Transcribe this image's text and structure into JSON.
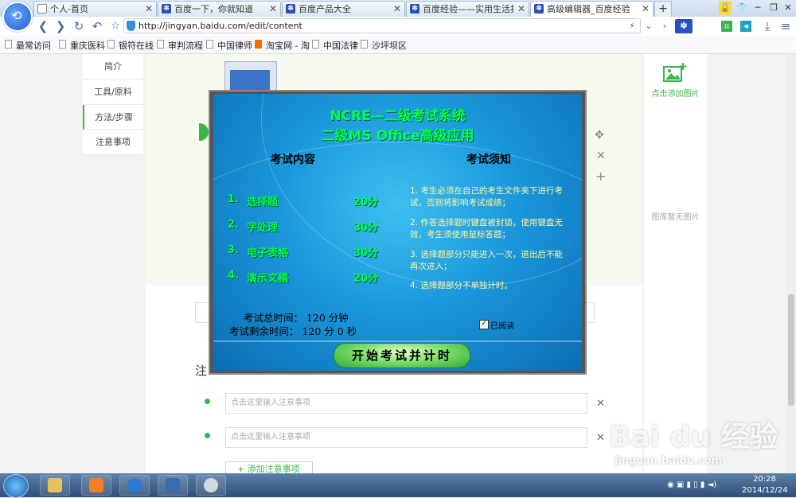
{
  "browser": {
    "tabs": [
      {
        "label": "个人-首页",
        "icon": "page-icon",
        "active": false
      },
      {
        "label": "百度一下，你就知道",
        "icon": "baidu-paw-icon",
        "active": false
      },
      {
        "label": "百度产品大全",
        "icon": "baidu-paw-icon",
        "active": false
      },
      {
        "label": "百度经验——实用生活指南",
        "icon": "baidu-paw-icon",
        "active": false
      },
      {
        "label": "高级编辑器_百度经验",
        "icon": "baidu-paw-icon",
        "active": true
      }
    ],
    "new_tab": "+",
    "url": "http://jingyan.baidu.com/edit/content",
    "bookmarks": [
      "最常访问",
      "重庆医科",
      "银符在线",
      "审判流程",
      "中国律师",
      "淘宝网 - 淘",
      "中国法律",
      "沙坪坝区"
    ]
  },
  "editor": {
    "left_nav": [
      "简介",
      "工具/原料",
      "方法/步骤",
      "注意事项"
    ],
    "active_nav": "方法/步骤",
    "right_panel": {
      "add_image": "点击添加图片",
      "no_image": "图库暂无图片"
    },
    "notes_title": "注",
    "note_placeholder": "点击这里输入注意事项",
    "add_note": "+ 添加注意事项"
  },
  "dialog": {
    "title_line1": "NCRE—二级考试系统",
    "title_line2": "二级MS Office高级应用",
    "content_header": "考试内容",
    "notice_header": "考试须知",
    "items": [
      {
        "num": "1.",
        "name": "选择题",
        "score": "20分"
      },
      {
        "num": "2.",
        "name": "字处理",
        "score": "30分"
      },
      {
        "num": "3.",
        "name": "电子表格",
        "score": "30分"
      },
      {
        "num": "4.",
        "name": "演示文稿",
        "score": "20分"
      }
    ],
    "notices": [
      "1. 考生必须在自己的考生文件夹下进行考试，否则将影响考试成绩；",
      "2. 作答选择题时键盘被封锁，使用键盘无效，考生须使用鼠标答题；",
      "3. 选择题部分只能进入一次，退出后不能再次进入；",
      "4. 选择题部分不单独计时。"
    ],
    "total_time": "考试总时间：  120 分钟",
    "remaining_time": "考试剩余时间：  120 分 0 秒",
    "read_label": "已阅读",
    "read_checked": "✓",
    "start_button": "开始考试并计时"
  },
  "watermark": {
    "brand": "Bai du 经验",
    "url": "jingyan.baidu.com"
  },
  "taskbar": {
    "time": "20:28",
    "date": "2014/12/24"
  }
}
